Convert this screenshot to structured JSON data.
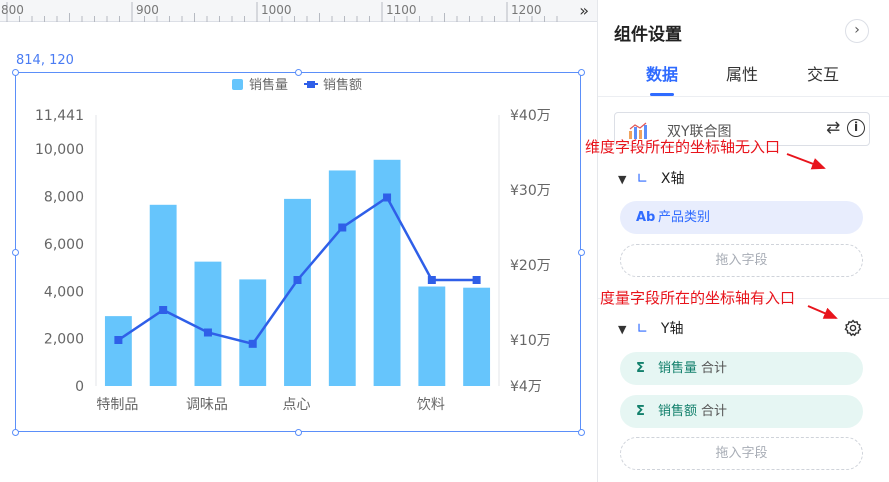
{
  "ruler": {
    "ticks": [
      "800",
      "900",
      "1000",
      "1100",
      "1200"
    ],
    "toggle": "»"
  },
  "selection": {
    "coords": "814, 120"
  },
  "chart_data": {
    "type": "bar",
    "categories": [
      "特制品",
      "",
      "调味品",
      "",
      "点心",
      "",
      "",
      "饮料",
      ""
    ],
    "x_tick_labels": [
      "特制品",
      "调味品",
      "点心",
      "饮料"
    ],
    "series": [
      {
        "name": "销售量",
        "type": "bar",
        "axis": "left",
        "values": [
          2950,
          7650,
          5250,
          4500,
          7900,
          9100,
          9550,
          4200,
          4150
        ]
      },
      {
        "name": "销售额",
        "type": "line",
        "axis": "right",
        "values": [
          100000,
          140000,
          110000,
          95000,
          180000,
          250000,
          290000,
          180000,
          180000
        ]
      }
    ],
    "y_left": {
      "ticks": [
        "0",
        "2,000",
        "4,000",
        "6,000",
        "8,000",
        "10,000",
        "11,441"
      ],
      "ylim": [
        0,
        11441
      ]
    },
    "y_right": {
      "ticks": [
        "¥4万",
        "¥10万",
        "¥20万",
        "¥30万",
        "¥40万"
      ]
    },
    "legend": {
      "position": "top-center",
      "items": [
        "销售量",
        "销售额"
      ]
    },
    "colors": {
      "bar": "#66c5fc",
      "line": "#2f5fe8"
    }
  },
  "panel": {
    "title": "组件设置",
    "collapse_icon": "chevron-right-icon",
    "tabs": [
      "数据",
      "属性",
      "交互"
    ],
    "chart_type": "双Y联合图",
    "x_axis": {
      "title": "X轴",
      "field": "产品类别",
      "field_icon": "Ab",
      "drop": "拖入字段"
    },
    "y_axis": {
      "title": "Y轴",
      "fields": [
        {
          "name": "销售量",
          "agg": "合计",
          "icon": "Σ"
        },
        {
          "name": "销售额",
          "agg": "合计",
          "icon": "Σ"
        }
      ],
      "drop": "拖入字段"
    }
  },
  "annotations": {
    "x_axis_note": "维度字段所在的坐标轴无入口",
    "y_axis_note": "度量字段所在的坐标轴有入口"
  }
}
